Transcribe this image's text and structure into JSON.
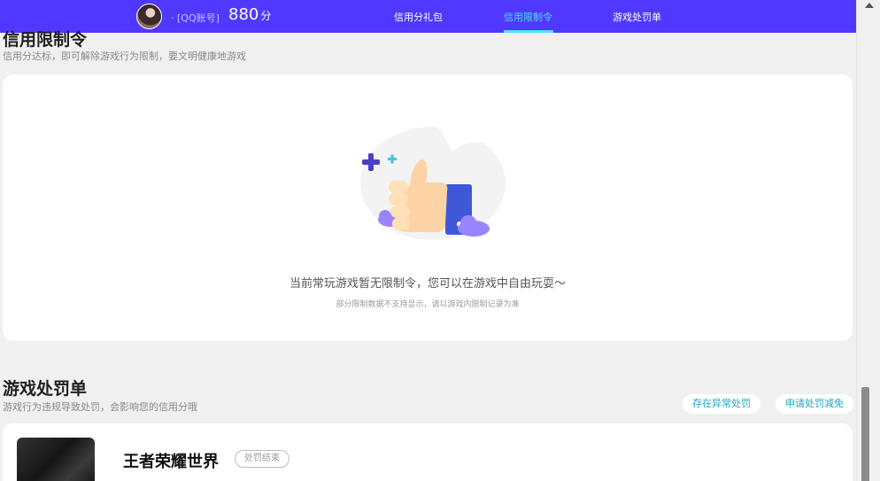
{
  "header": {
    "user_tag": "· [QQ账号]",
    "score": "880",
    "score_unit": "分",
    "tabs": [
      {
        "label": "信用分礼包"
      },
      {
        "label": "信用限制令"
      },
      {
        "label": "游戏处罚单"
      }
    ],
    "active_tab": 1,
    "accent_color": "#5038ff",
    "active_color": "#4ee2ff"
  },
  "restriction": {
    "title": "信用限制令",
    "desc": "信用分达标，即可解除游戏行为限制，要文明健康地游戏",
    "empty_text": "当前常玩游戏暂无限制令，您可以在游戏中自由玩耍～",
    "empty_sub": "部分限制数据不支持显示，请以游戏内限制记录为准",
    "illustration_icon": "thumbs-up-icon"
  },
  "penalty": {
    "title": "游戏处罚单",
    "desc": "游戏行为违规导致处罚，会影响您的信用分哦",
    "buttons": [
      {
        "label": "存在异常处罚"
      },
      {
        "label": "申请处罚减免"
      }
    ],
    "games": [
      {
        "name": "王者荣耀世界",
        "status": "处罚结束"
      }
    ]
  }
}
